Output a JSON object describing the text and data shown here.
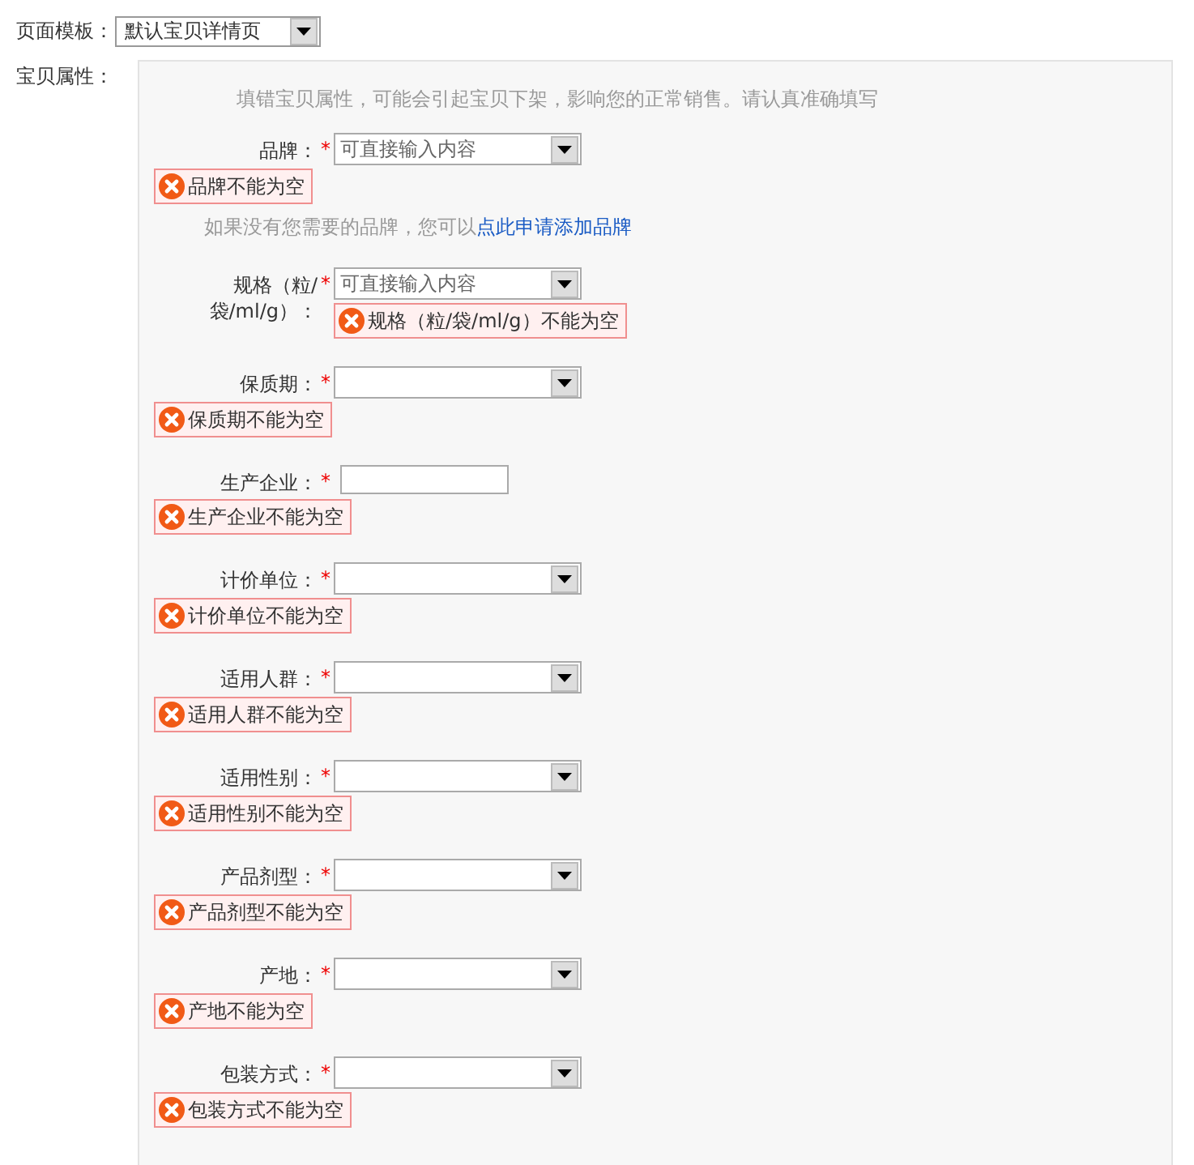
{
  "template": {
    "label": "页面模板：",
    "value": "默认宝贝详情页"
  },
  "attributes": {
    "label": "宝贝属性：",
    "notice": "填错宝贝属性，可能会引起宝贝下架，影响您的正常销售。请认真准确填写",
    "fields": [
      {
        "kind": "combo",
        "label": "品牌：",
        "mark": "*",
        "placeholder": "可直接输入内容",
        "error": "品牌不能为空",
        "error_inline": false,
        "hint": "如果没有您需要的品牌，您可以",
        "hint_link": "点此申请添加品牌"
      },
      {
        "kind": "combo",
        "label": "规格（粒/袋/ml/g）：",
        "mark": "*",
        "placeholder": "可直接输入内容",
        "error": "规格（粒/袋/ml/g）不能为空",
        "error_inline": true
      },
      {
        "kind": "select",
        "label": "保质期：",
        "mark": "*",
        "error": "保质期不能为空",
        "error_inline": false
      },
      {
        "kind": "text",
        "label": "生产企业：",
        "mark": "*",
        "error": "生产企业不能为空",
        "error_inline": false
      },
      {
        "kind": "select",
        "label": "计价单位：",
        "mark": "*",
        "error": "计价单位不能为空",
        "error_inline": false
      },
      {
        "kind": "select",
        "label": "适用人群：",
        "mark": "*",
        "error": "适用人群不能为空",
        "error_inline": false
      },
      {
        "kind": "select",
        "label": "适用性别：",
        "mark": "*",
        "error": "适用性别不能为空",
        "error_inline": false
      },
      {
        "kind": "select",
        "label": "产品剂型：",
        "mark": "*",
        "error": "产品剂型不能为空",
        "error_inline": false
      },
      {
        "kind": "select",
        "label": "产地：",
        "mark": "*",
        "error": "产地不能为空",
        "error_inline": false
      },
      {
        "kind": "select",
        "label": "包装方式：",
        "mark": "*",
        "error": "包装方式不能为空",
        "error_inline": false
      }
    ]
  }
}
